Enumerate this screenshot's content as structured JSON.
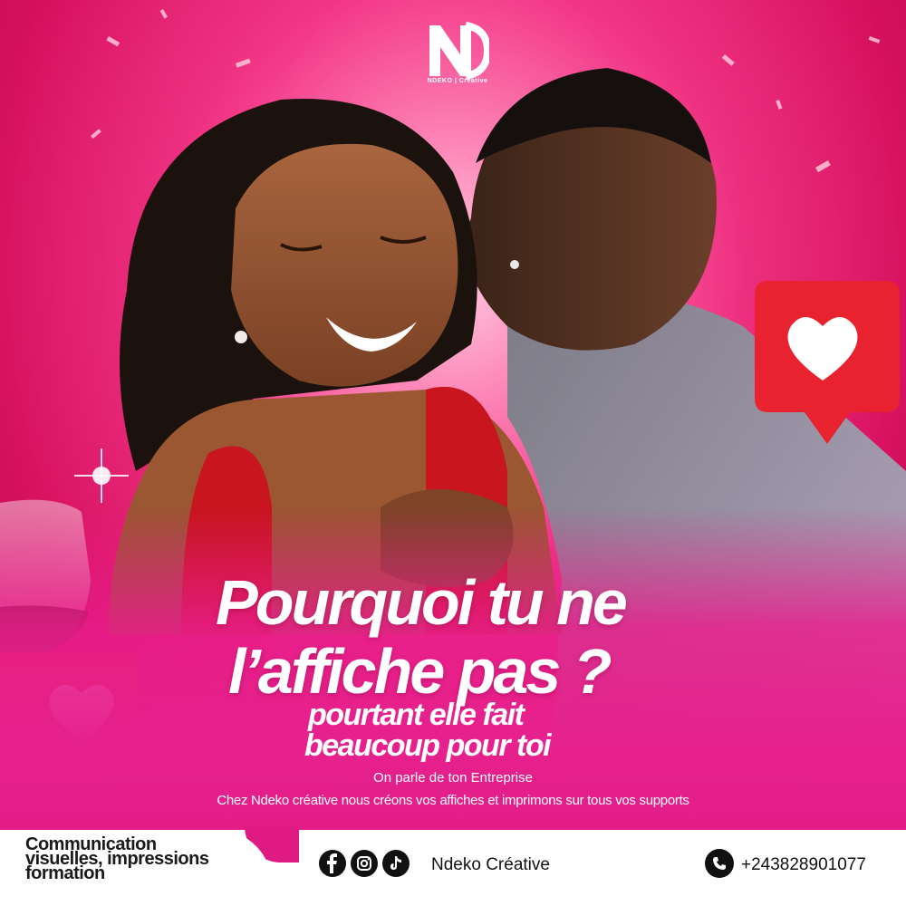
{
  "brand": {
    "logo_letters": "NDEKO",
    "logo_sub": "NDEKO | Créative"
  },
  "headline": {
    "line1": "Pourquoi tu ne",
    "line2": "l’affiche pas  ?",
    "sub1": "pourtant elle fait",
    "sub2": "beaucoup pour toi"
  },
  "tagline": {
    "line1": "On parle de ton Entreprise",
    "line2": "Chez Ndeko créative nous créons  vos  affiches  et  imprimons  sur  tous vos supports"
  },
  "footer": {
    "services": [
      "Communication",
      "visuelles, impressions",
      "formation"
    ],
    "brand_name": "Ndeko Créative",
    "phone": "+243828901077",
    "social_icons": [
      "facebook-icon",
      "instagram-icon",
      "tiktok-icon"
    ]
  },
  "colors": {
    "primary": "#e01a83",
    "heart_red": "#e8222e",
    "text_dark": "#111111"
  }
}
